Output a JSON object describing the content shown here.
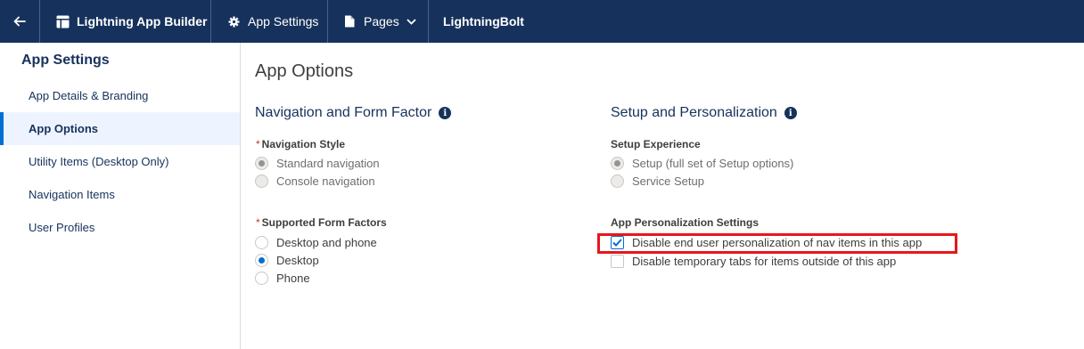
{
  "topbar": {
    "builder_label": "Lightning App Builder",
    "settings_label": "App Settings",
    "pages_label": "Pages",
    "app_name": "LightningBolt"
  },
  "sidebar": {
    "title": "App Settings",
    "items": [
      {
        "label": "App Details & Branding"
      },
      {
        "label": "App Options"
      },
      {
        "label": "Utility Items (Desktop Only)"
      },
      {
        "label": "Navigation Items"
      },
      {
        "label": "User Profiles"
      }
    ]
  },
  "main": {
    "title": "App Options",
    "nav_section": {
      "title": "Navigation and Form Factor",
      "navigation_style": {
        "label": "Navigation Style",
        "required_mark": "*",
        "options": [
          "Standard navigation",
          "Console navigation"
        ],
        "selected": "Standard navigation"
      },
      "form_factors": {
        "label": "Supported Form Factors",
        "required_mark": "*",
        "options": [
          "Desktop and phone",
          "Desktop",
          "Phone"
        ],
        "selected": "Desktop"
      }
    },
    "setup_section": {
      "title": "Setup and Personalization",
      "setup_experience": {
        "label": "Setup Experience",
        "options": [
          "Setup (full set of Setup options)",
          "Service Setup"
        ],
        "selected": "Setup (full set of Setup options)"
      },
      "personalization": {
        "label": "App Personalization Settings",
        "options": [
          {
            "label": "Disable end user personalization of nav items in this app",
            "checked": true
          },
          {
            "label": "Disable temporary tabs for items outside of this app",
            "checked": false
          }
        ]
      }
    }
  },
  "colors": {
    "topbar": "#16325c",
    "accent": "#0070d2",
    "highlight": "#e8161d"
  }
}
